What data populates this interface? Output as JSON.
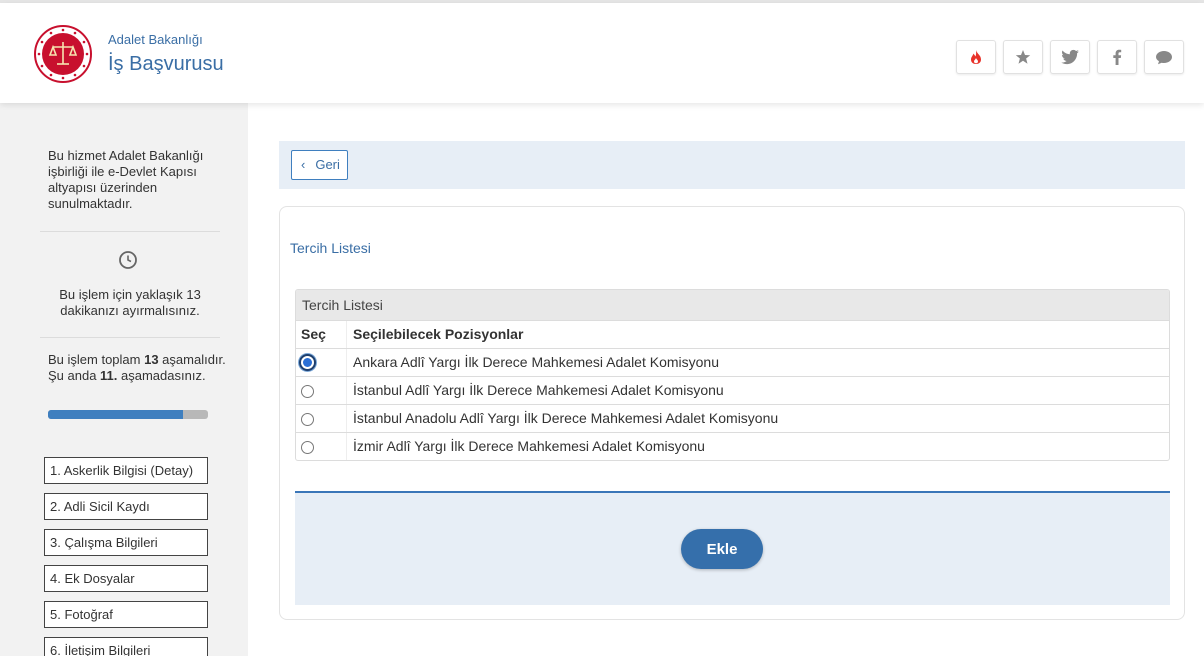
{
  "header": {
    "brand_small": "Adalet Bakanlığı",
    "brand_big": "İş Başvurusu",
    "buttons": [
      {
        "icon": "flame-icon",
        "color": "#e8322a"
      },
      {
        "icon": "star-icon",
        "color": "#888888"
      },
      {
        "icon": "twitter-icon",
        "color": "#888888"
      },
      {
        "icon": "facebook-icon",
        "color": "#888888"
      },
      {
        "icon": "chat-icon",
        "color": "#888888"
      }
    ]
  },
  "sidebar": {
    "info": "Bu hizmet Adalet Bakanlığı işbirliği ile e-Devlet Kapısı altyapısı üzerinden sunulmaktadır.",
    "time_text": "Bu işlem için yaklaşık 13 dakikanızı ayırmalısınız.",
    "steps_prefix": "Bu işlem toplam ",
    "steps_total": "13",
    "steps_middle": " aşamalıdır. Şu anda ",
    "steps_current": "11.",
    "steps_suffix": " aşamadasınız.",
    "progress_fraction": 0.846,
    "steps": [
      "1. Askerlik Bilgisi (Detay)",
      "2. Adli Sicil Kaydı",
      "3. Çalışma Bilgileri",
      "4. Ek Dosyalar",
      "5. Fotoğraf",
      "6. İletişim Bilgileri"
    ]
  },
  "main": {
    "back_label": "Geri",
    "card_title": "Tercih Listesi",
    "table": {
      "caption": "Tercih Listesi",
      "col_select": "Seç",
      "col_positions": "Seçilebilecek Pozisyonlar",
      "rows": [
        {
          "label": "Ankara Adlî Yargı İlk Derece Mahkemesi Adalet Komisyonu",
          "selected": true
        },
        {
          "label": "İstanbul Adlî Yargı İlk Derece Mahkemesi Adalet Komisyonu",
          "selected": false
        },
        {
          "label": "İstanbul Anadolu Adlî Yargı İlk Derece Mahkemesi Adalet Komisyonu",
          "selected": false
        },
        {
          "label": "İzmir Adlî Yargı İlk Derece Mahkemesi Adalet Komisyonu",
          "selected": false
        }
      ]
    },
    "add_label": "Ekle"
  },
  "colors": {
    "accent": "#3a6ea5",
    "button": "#356fab",
    "panel": "#e7eef6",
    "emblem": "#c8102e"
  }
}
